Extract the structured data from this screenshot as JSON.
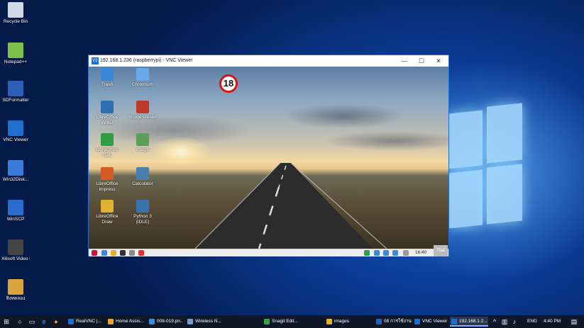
{
  "desktop": {
    "icons": [
      {
        "label": "Recycle Bin",
        "icon": "recycle-bin-icon",
        "color": "#cfd8e3"
      },
      {
        "label": "Notepad++",
        "icon": "notepad-plus-plus-icon",
        "color": "#7cc24a"
      },
      {
        "label": "SDFormatter",
        "icon": "sdformatter-icon",
        "color": "#2d5fb8"
      },
      {
        "label": "VNC Viewer",
        "icon": "vnc-viewer-icon",
        "color": "#1f6fd1"
      },
      {
        "label": "Win32Disk...",
        "icon": "win32diskimager-icon",
        "color": "#3a7ad9"
      },
      {
        "label": "WinSCP",
        "icon": "winscp-icon",
        "color": "#2b6ccf"
      },
      {
        "label": "Xilisoft Video Converter U...",
        "icon": "xilisoft-video-converter-icon",
        "color": "#444444"
      },
      {
        "label": "สิ่งทดลอง",
        "icon": "folder-book-icon",
        "color": "#d9a43a"
      }
    ]
  },
  "vnc_window": {
    "title": "192.168.1.236 (raspberrypi) - VNC Viewer",
    "app_icon_text": "V2",
    "minimize_label": "—",
    "maximize_label": "☐",
    "close_label": "✕",
    "badge_number": "18",
    "pi_icons": [
      {
        "label": "Trash",
        "icon": "trash-icon",
        "color": "#3c88d8"
      },
      {
        "label": "Chromium",
        "icon": "chromium-icon",
        "color": "#6aa7e8"
      },
      {
        "label": "LibreOffice Writer",
        "icon": "libreoffice-writer-icon",
        "color": "#2f6fb0"
      },
      {
        "label": "Image Viewer",
        "icon": "image-viewer-icon",
        "color": "#c0392b"
      },
      {
        "label": "LibreOffice Calc",
        "icon": "libreoffice-calc-icon",
        "color": "#2e9d45"
      },
      {
        "label": "Image",
        "icon": "image-icon",
        "color": "#5aa05a"
      },
      {
        "label": "LibreOffice Impress",
        "icon": "libreoffice-impress-icon",
        "color": "#d35a22"
      },
      {
        "label": "Calculator",
        "icon": "calculator-icon",
        "color": "#4a7fb0"
      },
      {
        "label": "LibreOffice Draw",
        "icon": "libreoffice-draw-icon",
        "color": "#e0b030"
      },
      {
        "label": "Python 3 (IDLE)",
        "icon": "python-icon",
        "color": "#3a74b0"
      }
    ],
    "panel_clock": "16:40",
    "panel_lang": "Thai"
  },
  "taskbar": {
    "items": [
      {
        "label": "RealVNC |...",
        "icon": "realvnc-icon",
        "color": "#1f6fd1"
      },
      {
        "label": "Home Assis...",
        "icon": "chrome-icon",
        "color": "#e8a23a"
      },
      {
        "label": "008-019.pn...",
        "icon": "image-file-icon",
        "color": "#3a8fd8"
      },
      {
        "label": "Wireless N...",
        "icon": "network-icon",
        "color": "#7a9ad0"
      },
      {
        "label": "Snagit Edit...",
        "icon": "snagit-icon",
        "color": "#3aa04a"
      },
      {
        "label": "images",
        "icon": "folder-icon",
        "color": "#e0b030"
      },
      {
        "label": "08 การใช้งาน...",
        "icon": "word-icon",
        "color": "#2b5fb3"
      },
      {
        "label": "VNC Viewer",
        "icon": "vnc-viewer-icon",
        "color": "#1f6fd1"
      },
      {
        "label": "192.168.1.2...",
        "icon": "vnc-viewer-icon",
        "color": "#1f6fd1"
      }
    ],
    "language": "ENG",
    "time": "4:40 PM"
  }
}
